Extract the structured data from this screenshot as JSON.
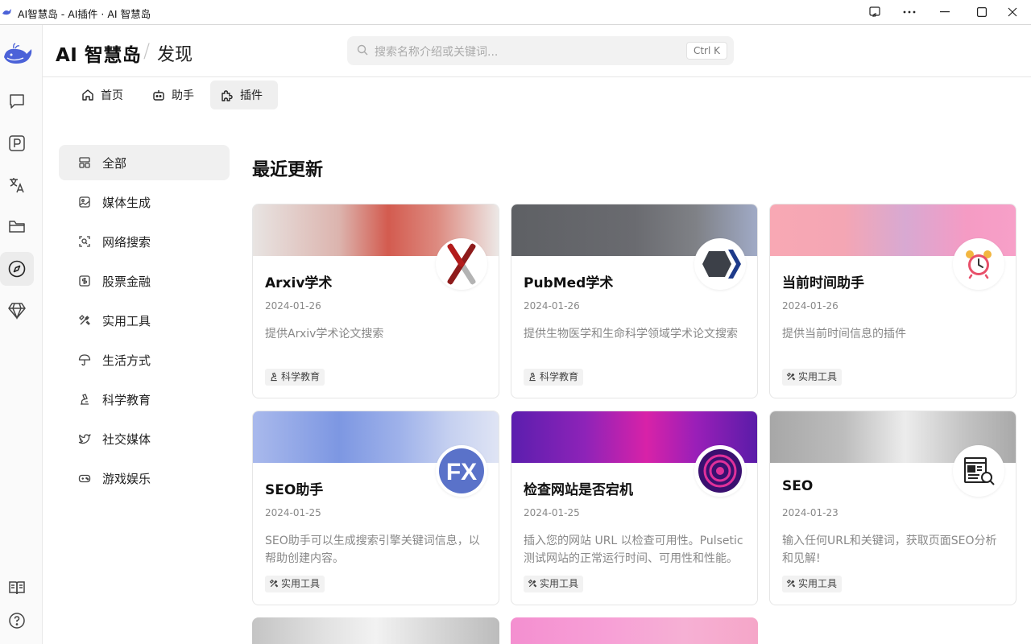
{
  "window": {
    "title": "AI智慧岛 - AI插件 · AI 智慧岛"
  },
  "header": {
    "brand": "AI 智慧岛",
    "separator": "/",
    "page": "发现",
    "search_placeholder": "搜索名称介绍或关键词...",
    "search_shortcut": "Ctrl K"
  },
  "rail": {
    "items": [
      "chat-icon",
      "prompt-icon",
      "translate-icon",
      "folder-icon",
      "discover-icon",
      "diamond-icon"
    ],
    "bottom": [
      "docs-icon",
      "help-icon"
    ]
  },
  "tabs": [
    {
      "label": "首页",
      "icon": "home-icon"
    },
    {
      "label": "助手",
      "icon": "bot-icon"
    },
    {
      "label": "插件",
      "icon": "puzzle-icon",
      "active": true
    }
  ],
  "categories": [
    {
      "label": "全部",
      "icon": "grid-icon",
      "active": true
    },
    {
      "label": "媒体生成",
      "icon": "image-icon"
    },
    {
      "label": "网络搜索",
      "icon": "scan-search-icon"
    },
    {
      "label": "股票金融",
      "icon": "dollar-icon"
    },
    {
      "label": "实用工具",
      "icon": "tool-icon"
    },
    {
      "label": "生活方式",
      "icon": "umbrella-icon"
    },
    {
      "label": "科学教育",
      "icon": "microscope-icon"
    },
    {
      "label": "社交媒体",
      "icon": "twitter-icon"
    },
    {
      "label": "游戏娱乐",
      "icon": "gamepad-icon"
    }
  ],
  "section_title": "最近更新",
  "cards": [
    {
      "title": "Arxiv学术",
      "date": "2024-01-26",
      "desc": "提供Arxiv学术论文搜索",
      "tag": "科学教育",
      "tag_icon": "microscope-icon",
      "avatar": "arxiv-logo"
    },
    {
      "title": "PubMed学术",
      "date": "2024-01-26",
      "desc": "提供生物医学和生命科学领域学术论文搜索",
      "tag": "科学教育",
      "tag_icon": "microscope-icon",
      "avatar": "pubmed-logo"
    },
    {
      "title": "当前时间助手",
      "date": "2024-01-26",
      "desc": "提供当前时间信息的插件",
      "tag": "实用工具",
      "tag_icon": "tool-icon",
      "avatar": "alarm-clock-icon"
    },
    {
      "title": "SEO助手",
      "date": "2024-01-25",
      "desc": "SEO助手可以生成搜索引擎关键词信息，以帮助创建内容。",
      "tag": "实用工具",
      "tag_icon": "tool-icon",
      "avatar": "fx-logo"
    },
    {
      "title": "检查网站是否宕机",
      "date": "2024-01-25",
      "desc": "插入您的网站 URL 以检查可用性。Pulsetic 测试网站的正常运行时间、可用性和性能。",
      "tag": "实用工具",
      "tag_icon": "tool-icon",
      "avatar": "pulse-logo"
    },
    {
      "title": "SEO",
      "date": "2024-01-23",
      "desc": "输入任何URL和关键词，获取页面SEO分析和见解!",
      "tag": "实用工具",
      "tag_icon": "tool-icon",
      "avatar": "seo-report-icon"
    }
  ],
  "colors": {
    "accent_blue": "#4b62d8",
    "tag_bg": "#f2f2f2"
  }
}
